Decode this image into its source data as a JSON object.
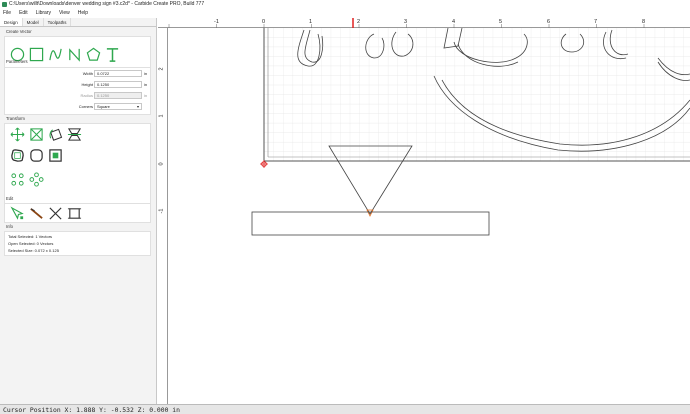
{
  "window": {
    "title": "C:\\Users\\willt\\Downloads\\denver wedding sign #3.c2d* - Carbide Create PRO, Build 777"
  },
  "menu": [
    {
      "label": "File"
    },
    {
      "label": "Edit"
    },
    {
      "label": "Library"
    },
    {
      "label": "View"
    },
    {
      "label": "Help"
    }
  ],
  "tabs": [
    {
      "label": "Design"
    },
    {
      "label": "Model"
    },
    {
      "label": "Toolpaths"
    }
  ],
  "create_vector": {
    "title": "Create Vector",
    "tools": [
      "circle-icon",
      "rectangle-icon",
      "curve-icon",
      "polyline-icon",
      "polygon-icon",
      "text-icon"
    ]
  },
  "parameters": {
    "title": "Parameters",
    "width": {
      "label": "Width",
      "value": "0.0722",
      "unit": "in"
    },
    "height": {
      "label": "Height",
      "value": "0.1250",
      "unit": "in"
    },
    "radius": {
      "label": "Radius",
      "value": "0.1250",
      "unit": "in"
    },
    "corners": {
      "label": "Corners",
      "value": "Square"
    }
  },
  "transform": {
    "title": "Transform",
    "tools": [
      "move-icon",
      "scale-icon",
      "rotate-icon",
      "mirror-icon",
      "offset-icon",
      "fillet-icon",
      "inset-icon",
      "array-icon",
      "circular-array-icon"
    ]
  },
  "edit": {
    "title": "Edit",
    "tools": [
      "node-edit-icon",
      "knife-icon",
      "trim-icon",
      "boolean-icon"
    ]
  },
  "info": {
    "title": "Info",
    "total_selected": "Total Selected:  1 Vectors",
    "open_selected": "Open Selected:  0 Vectors",
    "selected_size": "Selected Size:  0.072 x 0.125"
  },
  "ruler": {
    "top_labels": [
      "-1",
      "0",
      "1",
      "2",
      "3",
      "4",
      "5",
      "6",
      "7",
      "8"
    ],
    "left_labels": [
      "2",
      "1",
      "0",
      "-1"
    ]
  },
  "status": {
    "cursor": "Cursor Position X: 1.888 Y: -0.532 Z: 0.000 in"
  },
  "colors": {
    "accent": "#2fa84f",
    "origin": "#e02020",
    "grid": "#dcdcdc"
  }
}
